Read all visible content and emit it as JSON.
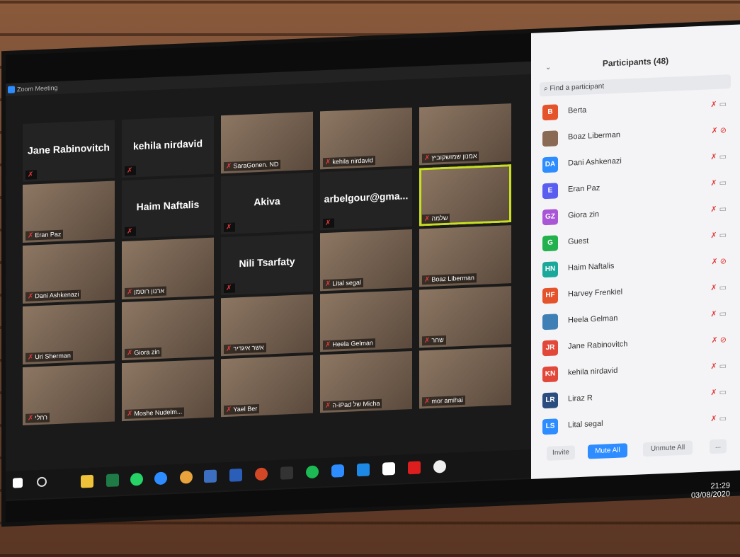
{
  "window": {
    "title": "Zoom Meeting"
  },
  "tiles": [
    {
      "name": "Jane Rabinovitch",
      "label": "",
      "video": false
    },
    {
      "name": "kehila nirdavid",
      "label": "",
      "video": false
    },
    {
      "name": "",
      "label": "SaraGonen. ND",
      "video": true
    },
    {
      "name": "",
      "label": "kehila nirdavid",
      "video": true
    },
    {
      "name": "",
      "label": "אמנון שמושקוביץ",
      "video": true
    },
    {
      "name": "",
      "label": "Eran Paz",
      "video": true
    },
    {
      "name": "Haim Naftalis",
      "label": "",
      "video": false
    },
    {
      "name": "Akiva",
      "label": "",
      "video": false
    },
    {
      "name": "arbelgour@gma...",
      "label": "",
      "video": false
    },
    {
      "name": "",
      "label": "שלמה",
      "video": true
    },
    {
      "name": "",
      "label": "Dani Ashkenazi",
      "video": true
    },
    {
      "name": "",
      "label": "ארנון רוטמן",
      "video": true
    },
    {
      "name": "Nili Tsarfaty",
      "label": "",
      "video": false
    },
    {
      "name": "",
      "label": "Lital segal",
      "video": true
    },
    {
      "name": "",
      "label": "Boaz Liberman",
      "video": true
    },
    {
      "name": "",
      "label": "Uri Sherman",
      "video": true
    },
    {
      "name": "",
      "label": "Giora zin",
      "video": true
    },
    {
      "name": "",
      "label": "אשר איגדיר",
      "video": true
    },
    {
      "name": "",
      "label": "Heela Gelman",
      "video": true
    },
    {
      "name": "",
      "label": "שחר",
      "video": true
    },
    {
      "name": "",
      "label": "רחלי",
      "video": true
    },
    {
      "name": "",
      "label": "Moshe Nudelm...",
      "video": true
    },
    {
      "name": "",
      "label": "Yael Ber",
      "video": true
    },
    {
      "name": "",
      "label": "ה-iPad של Micha",
      "video": true
    },
    {
      "name": "",
      "label": "mor amihai",
      "video": true
    }
  ],
  "participants": {
    "title": "Participants (48)",
    "search_placeholder": "Find a participant",
    "list": [
      {
        "initials": "B",
        "name": "Berta",
        "color": "#e5532c",
        "video_off": false
      },
      {
        "initials": "",
        "name": "Boaz Liberman",
        "color": "#8a6a55",
        "video_off": true
      },
      {
        "initials": "DA",
        "name": "Dani Ashkenazi",
        "color": "#2d8cff",
        "video_off": false
      },
      {
        "initials": "E",
        "name": "Eran Paz",
        "color": "#5a5ef0",
        "video_off": false
      },
      {
        "initials": "GZ",
        "name": "Giora zin",
        "color": "#a855d6",
        "video_off": false
      },
      {
        "initials": "G",
        "name": "Guest",
        "color": "#22b14c",
        "video_off": false
      },
      {
        "initials": "HN",
        "name": "Haim Naftalis",
        "color": "#1aa89a",
        "video_off": true
      },
      {
        "initials": "HF",
        "name": "Harvey Frenkiel",
        "color": "#e5532c",
        "video_off": false
      },
      {
        "initials": "",
        "name": "Heela Gelman",
        "color": "#3e7fb5",
        "video_off": false
      },
      {
        "initials": "JR",
        "name": "Jane Rabinovitch",
        "color": "#e2483a",
        "video_off": true
      },
      {
        "initials": "KN",
        "name": "kehila nirdavid",
        "color": "#e2483a",
        "video_off": false
      },
      {
        "initials": "LR",
        "name": "Liraz R",
        "color": "#2b4c7e",
        "video_off": false
      },
      {
        "initials": "LS",
        "name": "Lital segal",
        "color": "#2d8cff",
        "video_off": false
      }
    ],
    "buttons": {
      "invite": "Invite",
      "mute_all": "Mute All",
      "unmute_all": "Unmute All",
      "more": "..."
    }
  },
  "clock": {
    "time": "21:29",
    "date": "03/08/2020"
  }
}
